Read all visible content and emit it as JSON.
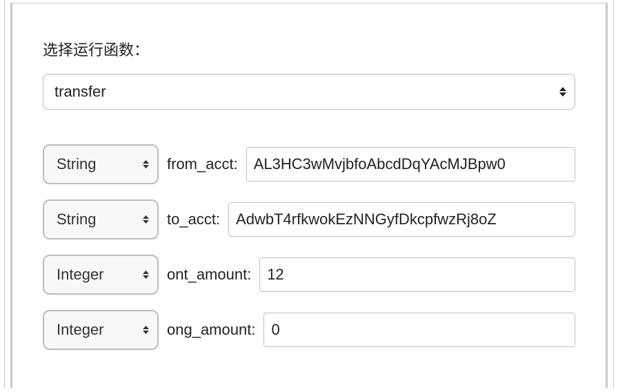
{
  "section_label": "选择运行函数：",
  "function_select": {
    "value": "transfer"
  },
  "type_options": {
    "string": "String",
    "integer": "Integer"
  },
  "params": [
    {
      "type_key": "string",
      "label": "from_acct:",
      "value": "AL3HC3wMvjbfoAbcdDqYAcMJBpw0"
    },
    {
      "type_key": "string",
      "label": "to_acct:",
      "value": "AdwbT4rfkwokEzNNGyfDkcpfwzRj8oZ"
    },
    {
      "type_key": "integer",
      "label": "ont_amount:",
      "value": "12"
    },
    {
      "type_key": "integer",
      "label": "ong_amount:",
      "value": "0"
    }
  ]
}
